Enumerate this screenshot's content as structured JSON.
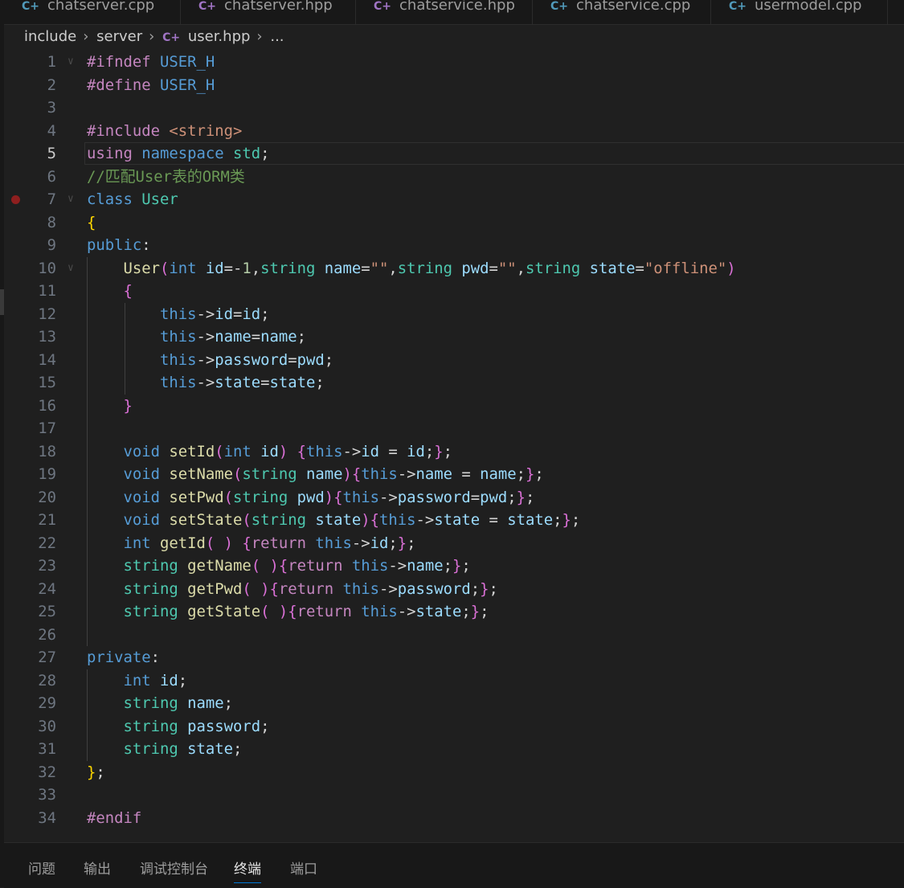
{
  "tabs": [
    {
      "label": "chatserver.cpp",
      "icon": "cpp-file-icon",
      "color": "#519aba"
    },
    {
      "label": "chatserver.hpp",
      "icon": "hpp-file-icon",
      "color": "#a074c4"
    },
    {
      "label": "chatservice.hpp",
      "icon": "hpp-file-icon",
      "color": "#a074c4"
    },
    {
      "label": "chatservice.cpp",
      "icon": "cpp-file-icon",
      "color": "#519aba"
    },
    {
      "label": "usermodel.cpp",
      "icon": "cpp-file-icon",
      "color": "#519aba"
    }
  ],
  "breadcrumb": {
    "items": [
      "include",
      "server"
    ],
    "file": "user.hpp",
    "more": "..."
  },
  "current_line": 5,
  "breakpoint_line": 7,
  "fold_lines": [
    1,
    7,
    10
  ],
  "lines": [
    [
      [
        "p",
        "#ifndef "
      ],
      [
        "m",
        "USER_H"
      ]
    ],
    [
      [
        "p",
        "#define "
      ],
      [
        "m",
        "USER_H"
      ]
    ],
    [],
    [
      [
        "p",
        "#include "
      ],
      [
        "s",
        "<string>"
      ]
    ],
    [
      [
        "p",
        "using "
      ],
      [
        "k",
        "namespace "
      ],
      [
        "t",
        "std"
      ],
      [
        "o",
        ";"
      ]
    ],
    [
      [
        "c",
        "//匹配User表的ORM类"
      ]
    ],
    [
      [
        "k",
        "class "
      ],
      [
        "t",
        "User"
      ]
    ],
    [
      [
        "b1",
        "{"
      ]
    ],
    [
      [
        "k",
        "public"
      ],
      [
        "o",
        ":"
      ]
    ],
    [
      [
        "o",
        "    "
      ],
      [
        "f",
        "User"
      ],
      [
        "b2",
        "("
      ],
      [
        "k",
        "int "
      ],
      [
        "v",
        "id"
      ],
      [
        "o",
        "=-"
      ],
      [
        "n",
        "1"
      ],
      [
        "o",
        ","
      ],
      [
        "t",
        "string "
      ],
      [
        "v",
        "name"
      ],
      [
        "o",
        "="
      ],
      [
        "s",
        "\"\""
      ],
      [
        "o",
        ","
      ],
      [
        "t",
        "string "
      ],
      [
        "v",
        "pwd"
      ],
      [
        "o",
        "="
      ],
      [
        "s",
        "\"\""
      ],
      [
        "o",
        ","
      ],
      [
        "t",
        "string "
      ],
      [
        "v",
        "state"
      ],
      [
        "o",
        "="
      ],
      [
        "s",
        "\"offline\""
      ],
      [
        "b2",
        ")"
      ]
    ],
    [
      [
        "o",
        "    "
      ],
      [
        "b2",
        "{"
      ]
    ],
    [
      [
        "o",
        "        "
      ],
      [
        "k",
        "this"
      ],
      [
        "o",
        "->"
      ],
      [
        "v",
        "id"
      ],
      [
        "o",
        "="
      ],
      [
        "v",
        "id"
      ],
      [
        "o",
        ";"
      ]
    ],
    [
      [
        "o",
        "        "
      ],
      [
        "k",
        "this"
      ],
      [
        "o",
        "->"
      ],
      [
        "v",
        "name"
      ],
      [
        "o",
        "="
      ],
      [
        "v",
        "name"
      ],
      [
        "o",
        ";"
      ]
    ],
    [
      [
        "o",
        "        "
      ],
      [
        "k",
        "this"
      ],
      [
        "o",
        "->"
      ],
      [
        "v",
        "password"
      ],
      [
        "o",
        "="
      ],
      [
        "v",
        "pwd"
      ],
      [
        "o",
        ";"
      ]
    ],
    [
      [
        "o",
        "        "
      ],
      [
        "k",
        "this"
      ],
      [
        "o",
        "->"
      ],
      [
        "v",
        "state"
      ],
      [
        "o",
        "="
      ],
      [
        "v",
        "state"
      ],
      [
        "o",
        ";"
      ]
    ],
    [
      [
        "o",
        "    "
      ],
      [
        "b2",
        "}"
      ]
    ],
    [],
    [
      [
        "o",
        "    "
      ],
      [
        "k",
        "void "
      ],
      [
        "f",
        "setId"
      ],
      [
        "b2",
        "("
      ],
      [
        "k",
        "int "
      ],
      [
        "v",
        "id"
      ],
      [
        "b2",
        ")"
      ],
      [
        "o",
        " "
      ],
      [
        "b2",
        "{"
      ],
      [
        "k",
        "this"
      ],
      [
        "o",
        "->"
      ],
      [
        "v",
        "id"
      ],
      [
        "o",
        " = "
      ],
      [
        "v",
        "id"
      ],
      [
        "o",
        ";"
      ],
      [
        "b2",
        "}"
      ],
      [
        "o",
        ";"
      ]
    ],
    [
      [
        "o",
        "    "
      ],
      [
        "k",
        "void "
      ],
      [
        "f",
        "setName"
      ],
      [
        "b2",
        "("
      ],
      [
        "t",
        "string "
      ],
      [
        "v",
        "name"
      ],
      [
        "b2",
        ")"
      ],
      [
        "b2",
        "{"
      ],
      [
        "k",
        "this"
      ],
      [
        "o",
        "->"
      ],
      [
        "v",
        "name"
      ],
      [
        "o",
        " = "
      ],
      [
        "v",
        "name"
      ],
      [
        "o",
        ";"
      ],
      [
        "b2",
        "}"
      ],
      [
        "o",
        ";"
      ]
    ],
    [
      [
        "o",
        "    "
      ],
      [
        "k",
        "void "
      ],
      [
        "f",
        "setPwd"
      ],
      [
        "b2",
        "("
      ],
      [
        "t",
        "string "
      ],
      [
        "v",
        "pwd"
      ],
      [
        "b2",
        ")"
      ],
      [
        "b2",
        "{"
      ],
      [
        "k",
        "this"
      ],
      [
        "o",
        "->"
      ],
      [
        "v",
        "password"
      ],
      [
        "o",
        "="
      ],
      [
        "v",
        "pwd"
      ],
      [
        "o",
        ";"
      ],
      [
        "b2",
        "}"
      ],
      [
        "o",
        ";"
      ]
    ],
    [
      [
        "o",
        "    "
      ],
      [
        "k",
        "void "
      ],
      [
        "f",
        "setState"
      ],
      [
        "b2",
        "("
      ],
      [
        "t",
        "string "
      ],
      [
        "v",
        "state"
      ],
      [
        "b2",
        ")"
      ],
      [
        "b2",
        "{"
      ],
      [
        "k",
        "this"
      ],
      [
        "o",
        "->"
      ],
      [
        "v",
        "state"
      ],
      [
        "o",
        " = "
      ],
      [
        "v",
        "state"
      ],
      [
        "o",
        ";"
      ],
      [
        "b2",
        "}"
      ],
      [
        "o",
        ";"
      ]
    ],
    [
      [
        "o",
        "    "
      ],
      [
        "k",
        "int "
      ],
      [
        "f",
        "getId"
      ],
      [
        "b2",
        "("
      ],
      [
        "o",
        " "
      ],
      [
        "b2",
        ")"
      ],
      [
        "o",
        " "
      ],
      [
        "b2",
        "{"
      ],
      [
        "p",
        "return "
      ],
      [
        "k",
        "this"
      ],
      [
        "o",
        "->"
      ],
      [
        "v",
        "id"
      ],
      [
        "o",
        ";"
      ],
      [
        "b2",
        "}"
      ],
      [
        "o",
        ";"
      ]
    ],
    [
      [
        "o",
        "    "
      ],
      [
        "t",
        "string "
      ],
      [
        "f",
        "getName"
      ],
      [
        "b2",
        "("
      ],
      [
        "o",
        " "
      ],
      [
        "b2",
        ")"
      ],
      [
        "b2",
        "{"
      ],
      [
        "p",
        "return "
      ],
      [
        "k",
        "this"
      ],
      [
        "o",
        "->"
      ],
      [
        "v",
        "name"
      ],
      [
        "o",
        ";"
      ],
      [
        "b2",
        "}"
      ],
      [
        "o",
        ";"
      ]
    ],
    [
      [
        "o",
        "    "
      ],
      [
        "t",
        "string "
      ],
      [
        "f",
        "getPwd"
      ],
      [
        "b2",
        "("
      ],
      [
        "o",
        " "
      ],
      [
        "b2",
        ")"
      ],
      [
        "b2",
        "{"
      ],
      [
        "p",
        "return "
      ],
      [
        "k",
        "this"
      ],
      [
        "o",
        "->"
      ],
      [
        "v",
        "password"
      ],
      [
        "o",
        ";"
      ],
      [
        "b2",
        "}"
      ],
      [
        "o",
        ";"
      ]
    ],
    [
      [
        "o",
        "    "
      ],
      [
        "t",
        "string "
      ],
      [
        "f",
        "getState"
      ],
      [
        "b2",
        "("
      ],
      [
        "o",
        " "
      ],
      [
        "b2",
        ")"
      ],
      [
        "b2",
        "{"
      ],
      [
        "p",
        "return "
      ],
      [
        "k",
        "this"
      ],
      [
        "o",
        "->"
      ],
      [
        "v",
        "state"
      ],
      [
        "o",
        ";"
      ],
      [
        "b2",
        "}"
      ],
      [
        "o",
        ";"
      ]
    ],
    [],
    [
      [
        "k",
        "private"
      ],
      [
        "o",
        ":"
      ]
    ],
    [
      [
        "o",
        "    "
      ],
      [
        "k",
        "int "
      ],
      [
        "v",
        "id"
      ],
      [
        "o",
        ";"
      ]
    ],
    [
      [
        "o",
        "    "
      ],
      [
        "t",
        "string "
      ],
      [
        "v",
        "name"
      ],
      [
        "o",
        ";"
      ]
    ],
    [
      [
        "o",
        "    "
      ],
      [
        "t",
        "string "
      ],
      [
        "v",
        "password"
      ],
      [
        "o",
        ";"
      ]
    ],
    [
      [
        "o",
        "    "
      ],
      [
        "t",
        "string "
      ],
      [
        "v",
        "state"
      ],
      [
        "o",
        ";"
      ]
    ],
    [
      [
        "b1",
        "}"
      ],
      [
        "o",
        ";"
      ]
    ],
    [],
    [
      [
        "p",
        "#endif"
      ]
    ]
  ],
  "panel": {
    "tabs": [
      "问题",
      "输出",
      "调试控制台",
      "终端",
      "端口"
    ],
    "active": "终端"
  }
}
